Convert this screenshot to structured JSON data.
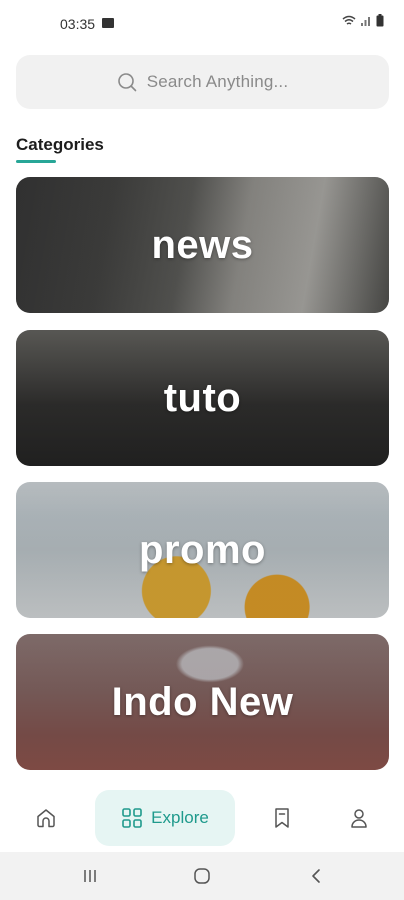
{
  "status_bar": {
    "time": "03:35",
    "icons": [
      "gallery-icon",
      "wifi-icon",
      "signal-icon",
      "battery-icon"
    ]
  },
  "search": {
    "placeholder": "Search Anything...",
    "icon": "search-icon"
  },
  "categories": {
    "title": "Categories",
    "accent_color": "#27a697",
    "items": [
      {
        "label": "news"
      },
      {
        "label": "tuto"
      },
      {
        "label": "promo"
      },
      {
        "label": "Indo New"
      }
    ]
  },
  "bottom_nav": {
    "active_color": "#1f9a8c",
    "active_background": "#e6f5f3",
    "items": [
      {
        "icon": "home-icon",
        "label": "",
        "active": false
      },
      {
        "icon": "explore-icon",
        "label": "Explore",
        "active": true
      },
      {
        "icon": "bookmark-icon",
        "label": "",
        "active": false
      },
      {
        "icon": "profile-icon",
        "label": "",
        "active": false
      }
    ]
  },
  "system_nav": {
    "buttons": [
      "recent-apps-icon",
      "home-circle-icon",
      "back-icon"
    ]
  }
}
